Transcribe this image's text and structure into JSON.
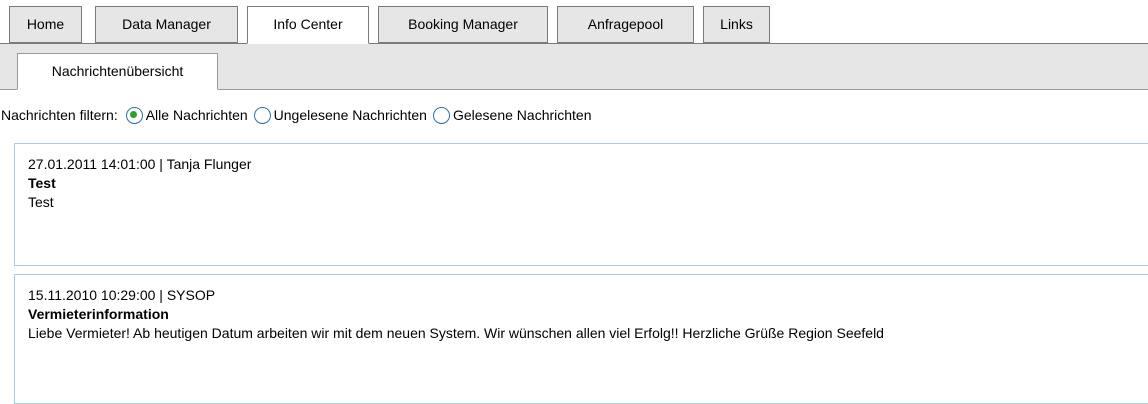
{
  "nav": {
    "tabs": [
      {
        "label": "Home"
      },
      {
        "label": "Data Manager"
      },
      {
        "label": "Info Center"
      },
      {
        "label": "Booking Manager"
      },
      {
        "label": "Anfragepool"
      },
      {
        "label": "Links"
      }
    ],
    "active": "Info Center"
  },
  "subnav": {
    "tabs": [
      {
        "label": "Nachrichtenübersicht"
      }
    ]
  },
  "filter": {
    "label": "Nachrichten filtern:",
    "options": [
      {
        "label": "Alle Nachrichten",
        "selected": true
      },
      {
        "label": "Ungelesene Nachrichten",
        "selected": false
      },
      {
        "label": "Gelesene Nachrichten",
        "selected": false
      }
    ]
  },
  "messages": [
    {
      "meta": "27.01.2011 14:01:00 | Tanja Flunger",
      "title": "Test",
      "body": "Test"
    },
    {
      "meta": "15.11.2010 10:29:00 | SYSOP",
      "title": "Vermieterinformation",
      "body": "Liebe Vermieter! Ab heutigen Datum arbeiten wir mit dem neuen System. Wir wünschen allen viel Erfolg!! Herzliche Grüße Region Seefeld"
    }
  ],
  "colors": {
    "tab_inactive": "#e6e6e6",
    "border": "#7a7a7a",
    "message_border": "#a8cfe0",
    "radio_selected": "#2ca02c",
    "radio_ring": "#2f6fa8"
  }
}
